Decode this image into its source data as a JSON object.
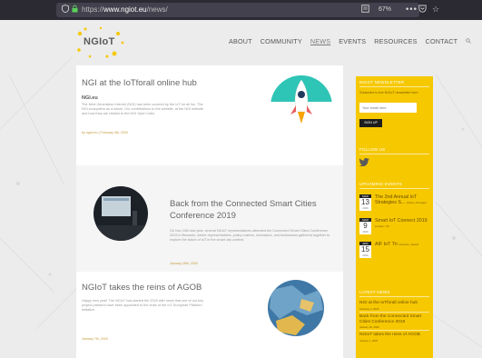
{
  "browser": {
    "shield_icon": "shield-icon",
    "lock_icon": "lock-icon",
    "url_scheme": "https://",
    "url_host": "www.ngiot.eu",
    "url_path": "/news/",
    "zoom": "67%",
    "more_icon": "ellipsis-icon",
    "pocket_icon": "pocket-icon",
    "bookmark_icon": "star-icon"
  },
  "header": {
    "logo_text": "NGIoT",
    "nav": [
      "ABOUT",
      "COMMUNITY",
      "NEWS",
      "EVENTS",
      "RESOURCES",
      "CONTACT"
    ],
    "active_nav": "NEWS"
  },
  "posts": [
    {
      "title": "NGI at the IoTforall online hub",
      "sub": "NGI.eu",
      "body": "The Next Generation Internet (NGI) has been covered by the IoT for all Inc, The NGI ecosystem as a whole. Our contributions to the website, at the NGI website and how they are related to the NGI Open Calls.",
      "meta": "by ngiot.eu | February 4th, 2020"
    },
    {
      "title": "Back from the Connected Smart Cities Conference 2019",
      "body": "On Nov 13th last year, several NGIoT representatives attended the Connected Smart Cities Conference 2019 in Brussels, where representatives, policy makers, innovators, and businesses gathered together to explore the future of IoT in the smart city context.",
      "meta": "January 29th, 2020"
    },
    {
      "title": "NGIoT takes the reins of AGOB",
      "body": "Happy new year! The NGIoT has started the 2020 with news that one of our key project partners have been appointed to the chair of the IoT European Platform Initiative.",
      "meta": "January 7th, 2020"
    }
  ],
  "sidebar": {
    "newsletter": {
      "title": "NGIOT NEWSLETTER",
      "text": "Subscribe to the NGIoT newsletter here",
      "placeholder": "Your email here",
      "button": "SIGN UP"
    },
    "follow": {
      "title": "FOLLOW US",
      "icon": "twitter-icon"
    },
    "events": {
      "title": "UPCOMING EVENTS",
      "items": [
        {
          "mon": "MAR",
          "day": "13",
          "yr": "2020",
          "title": "The 2nd Annual IoT Strategies S...",
          "loc": "Lisbon, Portugal"
        },
        {
          "mon": "MAR",
          "day": "9",
          "yr": "2020",
          "title": "Smart IoT Connect 2019",
          "loc": "London, UK"
        },
        {
          "mon": "APR",
          "day": "15",
          "yr": "2020",
          "title": "AIF IoT Tri",
          "loc": "Limerick, Ireland"
        }
      ]
    },
    "latest": {
      "title": "LATEST NEWS",
      "items": [
        {
          "title": "NGI at the IoTforall online hub",
          "date": "February 4, 2020"
        },
        {
          "title": "Back from the Connected Smart Cities Conference 2019",
          "date": "January 29, 2020"
        },
        {
          "title": "NGIoT takes the reins of AGOB",
          "date": "January 7, 2020"
        }
      ]
    }
  },
  "colors": {
    "accent": "#f6c800",
    "chrome": "#2b2a33"
  }
}
